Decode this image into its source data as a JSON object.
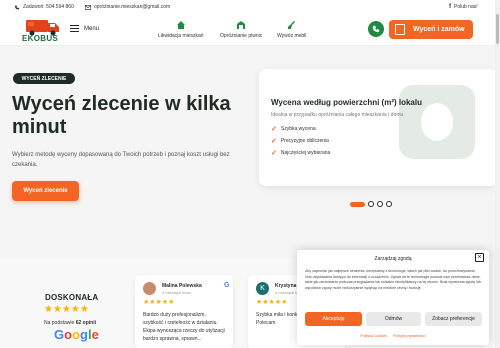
{
  "topbar": {
    "phone": "Zadzwoń: 504 594 860",
    "email": "opróżnianie.mieszkan@gmail.com",
    "facebook": "Polub nas!"
  },
  "header": {
    "logo_text": "EKOBUS",
    "menu_label": "Menu",
    "nav": [
      {
        "label": "Likwidacja mieszkań",
        "icon": "house-icon"
      },
      {
        "label": "Opróżnianie piwnic",
        "icon": "basement-icon"
      },
      {
        "label": "Wywóz mebli",
        "icon": "broom-icon"
      }
    ],
    "cta_label": "Wyceń i zamów"
  },
  "hero": {
    "tag": "WYCEŃ ZLECENIE",
    "title": "Wyceń zlecenie w kilka minut",
    "subtitle": "Wybierz metodę wyceny dopasowaną do Twoich potrzeb i poznaj koszt usługi bez czekania.",
    "cta_label": "Wyceń zlecenie"
  },
  "pricing_card": {
    "title": "Wycena według powierzchni (m²) lokalu",
    "description": "Idealna w przypadku opróżniania całego mieszkania / domu",
    "features": [
      "Szybka wycena",
      "Precyzyjne obliczenia",
      "Najczęściej wybierana"
    ]
  },
  "carousel": {
    "total": 4,
    "active": 1
  },
  "reviews": {
    "rating_word": "DOSKONAŁA",
    "stars": "★★★★★",
    "basis_prefix": "Na podstawie",
    "basis_count": "62 opinii",
    "google": "Google",
    "items": [
      {
        "name": "Malina Polewska",
        "time": "4 miesiące temu",
        "stars": "★★★★★",
        "text": "Bardzo duży profesjonalizm, szybkość i rzetelność w działaniu. Ekipa wynosząca rzeczy do utylizacji bardzo sprawna, sprawn..."
      },
      {
        "name": "Krystyna",
        "initial": "K",
        "time": "4 miesiące temu",
        "stars": "★★★★★",
        "text": "Szybka miła i konkretna obsługa. Polecam"
      }
    ]
  },
  "cookie": {
    "title": "Zarządzaj zgodą",
    "text": "Aby zapewnić jak najlepsze wrażenia, korzystamy z technologii, takich jak pliki cookie, do przechowywania i/lub uzyskiwania dostępu do informacji o urządzeniu. Zgoda na te technologie pozwoli nam przetwarzać dane, takie jak zachowanie podczas przeglądania lub unikalne identyfikatory na tej stronie. Brak wyrażenia zgody lub wycofanie zgody może niekorzystnie wpłynąć na niektóre cechy i funkcje.",
    "accept": "Akceptuję",
    "deny": "Odmów",
    "preferences": "Zobacz preferencje",
    "link_cookies": "Polityka Cookies",
    "link_privacy": "Polityka prywatności"
  },
  "colors": {
    "accent": "#f26522",
    "brand_green": "#1f8a43",
    "dark": "#1f2b24",
    "star": "#f7b500"
  }
}
